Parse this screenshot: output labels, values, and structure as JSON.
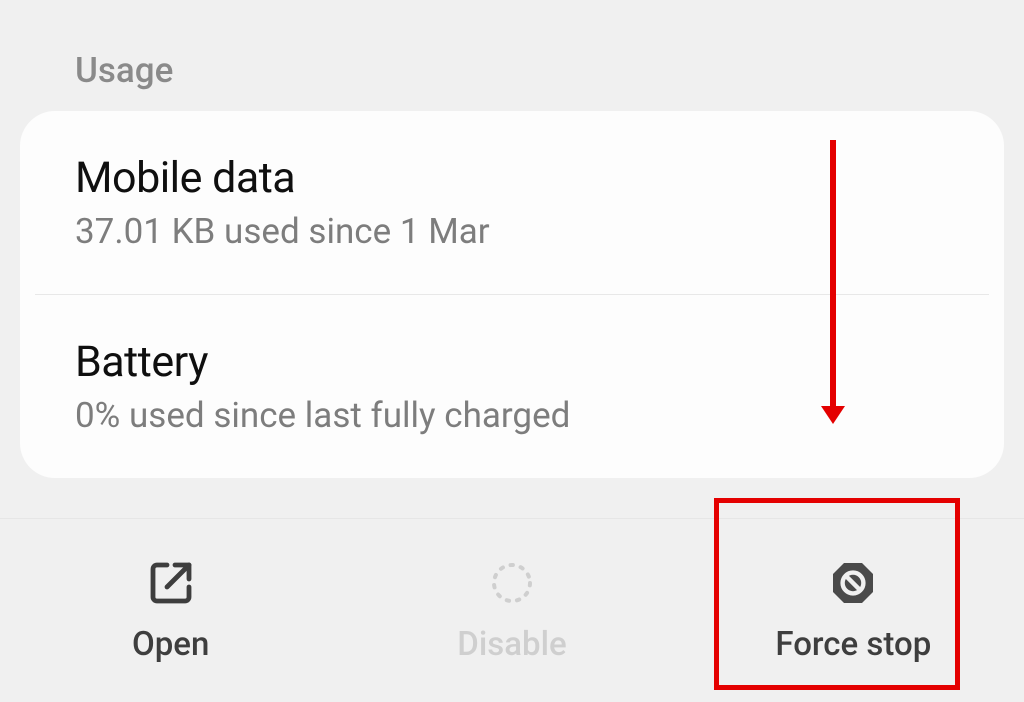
{
  "section_header": "Usage",
  "usage": {
    "mobile_data": {
      "title": "Mobile data",
      "subtitle": "37.01 KB used since 1 Mar"
    },
    "battery": {
      "title": "Battery",
      "subtitle": "0% used since last fully charged"
    }
  },
  "bottom_actions": {
    "open": "Open",
    "disable": "Disable",
    "force_stop": "Force stop"
  }
}
